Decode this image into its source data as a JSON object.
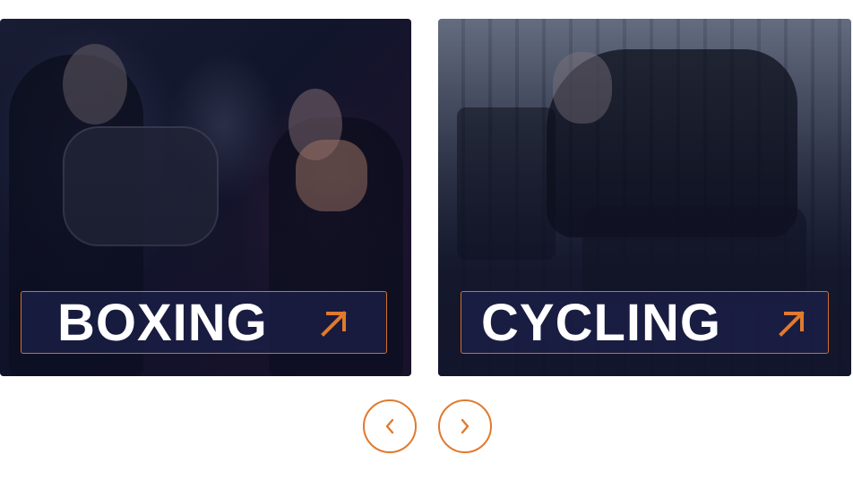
{
  "carousel": {
    "cards": [
      {
        "label": "BOXING",
        "icon": "arrow-up-right-icon"
      },
      {
        "label": "CYCLING",
        "icon": "arrow-up-right-icon"
      }
    ],
    "prev_icon": "chevron-left-icon",
    "next_icon": "chevron-right-icon"
  },
  "colors": {
    "accent": "#e07a2e",
    "label_bg": "#1c204a",
    "label_text": "#ffffff"
  }
}
